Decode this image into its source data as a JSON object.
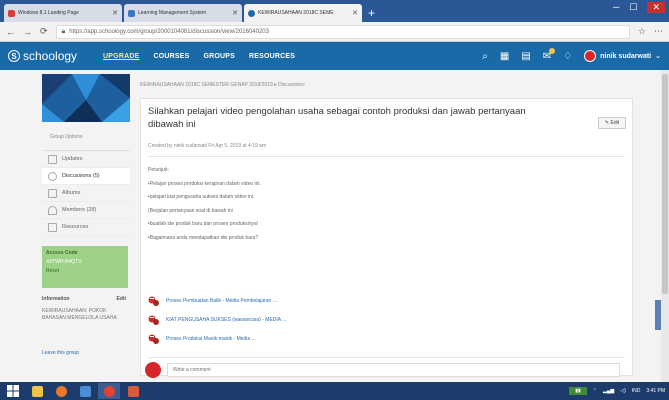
{
  "browser": {
    "tabs": [
      {
        "label": "Windows 8.1 Landing Page",
        "color": "#d93a3a",
        "active": false
      },
      {
        "label": "Learning Management System",
        "color": "#3b77c9",
        "active": false
      },
      {
        "label": "KEWIRAUSAHAAN 2018C SEME",
        "color": "#1a6aa8",
        "active": true
      }
    ],
    "url": "https://app.schoology.com/group/2000104081/discussion/view/2016040203"
  },
  "nav": {
    "logo": "schoology",
    "links": [
      "UPGRADE",
      "COURSES",
      "GROUPS",
      "RESOURCES"
    ],
    "user_name": "ninik sudarwati"
  },
  "sidebar": {
    "group_options": "Group Options",
    "items": [
      {
        "label": "Updates",
        "active": false
      },
      {
        "label": "Discussions (5)",
        "active": true
      },
      {
        "label": "Albums",
        "active": false
      },
      {
        "label": "Members (28)",
        "active": false
      },
      {
        "label": "Resources",
        "active": false
      }
    ],
    "access_code_label": "Access Code",
    "access_code": "X6TWH-B4QTV",
    "reset_label": "Reset",
    "info_label": "Information",
    "info_edit": "Edit",
    "info_text": "KEWIRAUSAHAAN: POKOK BAHASAN MENGELOLA USAHA",
    "leave": "Leave this group"
  },
  "main": {
    "breadcrumb": "KEWIRAUSAHAAN 2018C SEMESTER GENAP 2018/2019 ▸ Discussions",
    "title": "Silahkan pelajari video pengolahan usaha sebagai contoh produksi dan jawab pertanyaan dibawah ini",
    "edit_label": "Edit",
    "created": "Created by ninik sudarwati Fri Apr 5, 2019 at 4:19 am",
    "instructions": [
      "Petunjuk:",
      "•Pelajari proses produksi kerajinan dalam video ini.",
      "•pelajari kiat pengusaha sukses dalam video ini.",
      "(Berjalan pertanyaan soal di bawah ini",
      "•buatlah ide produk baru dan proses produksinya!",
      "•Bagaimana anda mendapatkan ide produk baru?"
    ],
    "attachments": [
      "Proses Pembuatan Batik - Media Pembelajaran ...",
      "KIAT PENGUSAHA SUKSES (wawancara) - MEDIA ...",
      "Proses Produksi Manik-manik - Media ..."
    ],
    "comment_placeholder": "Write a comment"
  },
  "taskbar": {
    "tray_text": "IND",
    "clock": "3:41 PM"
  }
}
